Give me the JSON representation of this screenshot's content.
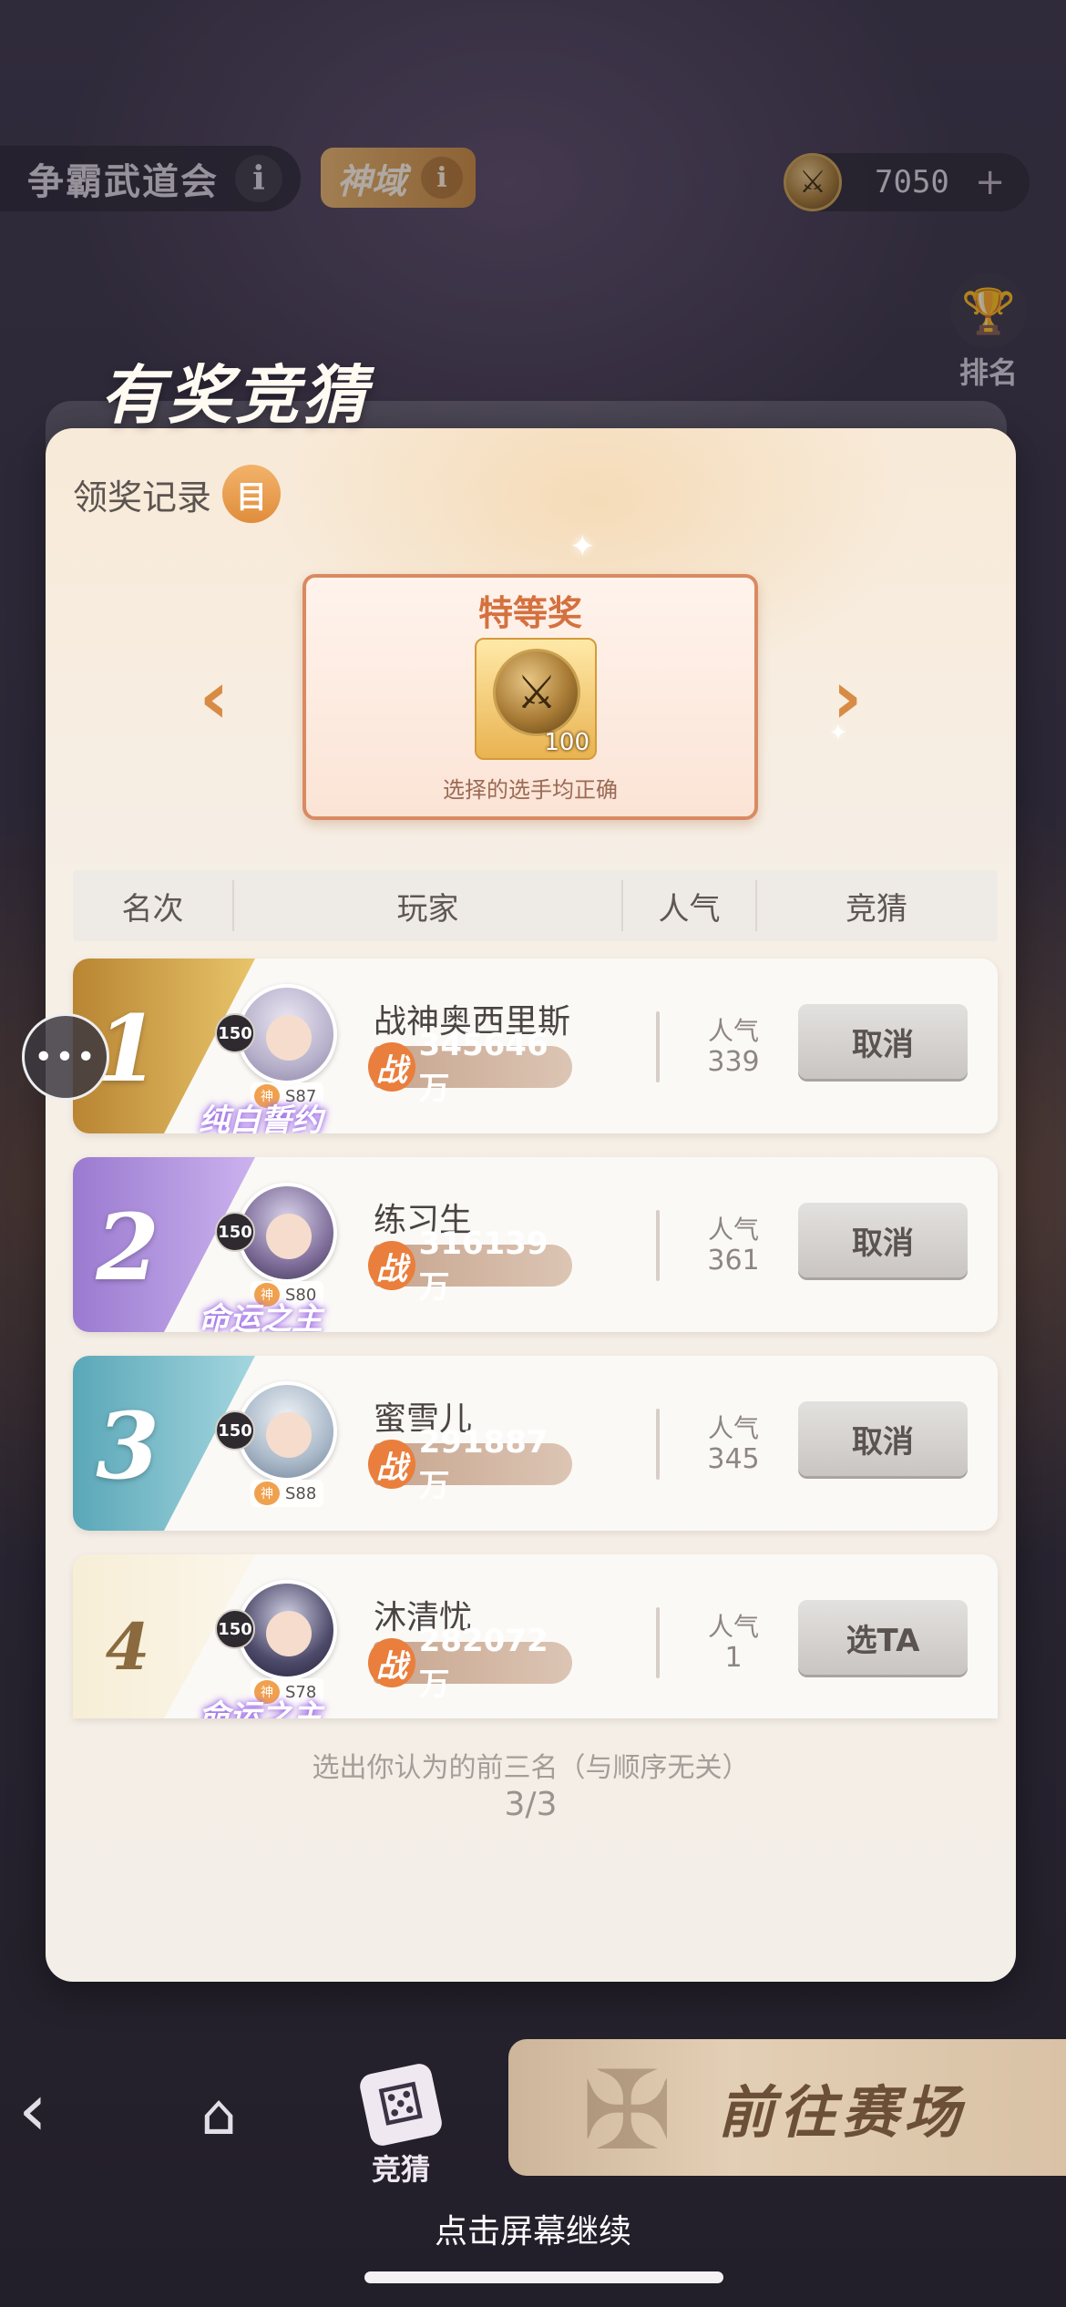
{
  "top_bar": {
    "event_title": "争霸武道会",
    "realm_tag": "神域",
    "info_glyph": "i",
    "currency_amount": "7050",
    "currency_plus": "+",
    "ranking_label": "排名"
  },
  "modal": {
    "title": "有奖竞猜",
    "records_label": "领奖记录",
    "records_icon_glyph": "目",
    "prize": {
      "title": "特等奖",
      "quantity": "100",
      "condition": "选择的选手均正确"
    },
    "table_headers": [
      "名次",
      "玩家",
      "人气",
      "竞猜"
    ],
    "popularity_label": "人气",
    "power_glyph": "战",
    "rows": [
      {
        "rank": "1",
        "level": "150",
        "server": "S87",
        "god_tag": "神",
        "title": "纯白誓约",
        "name": "战神奥西里斯",
        "power": "345646万",
        "popularity": "339",
        "button": "取消"
      },
      {
        "rank": "2",
        "level": "150",
        "server": "S80",
        "god_tag": "神",
        "title": "命运之主",
        "name": "练习生",
        "power": "316139万",
        "popularity": "361",
        "button": "取消"
      },
      {
        "rank": "3",
        "level": "150",
        "server": "S88",
        "god_tag": "神",
        "title": "",
        "name": "蜜雪儿",
        "power": "291887万",
        "popularity": "345",
        "button": "取消"
      },
      {
        "rank": "4",
        "level": "150",
        "server": "S78",
        "god_tag": "神",
        "title": "命运之主",
        "name": "沐清忧",
        "power": "282072万",
        "popularity": "1",
        "button": "选TA"
      }
    ],
    "hint": "选出你认为的前三名（与顺序无关）",
    "selected_count": "3/3"
  },
  "bottom_nav": {
    "guess_label": "竞猜",
    "go_arena_label": "前往赛场",
    "tap_continue": "点击屏幕继续"
  },
  "icons": {
    "back": "back-arrow-icon",
    "home": "home-icon",
    "dice": "dice-icon",
    "coin": "coin-icon",
    "trophy": "trophy-icon",
    "chat": "chat-icon"
  },
  "colors": {
    "accent_orange": "#e08d3c",
    "rank1": "#c9963a",
    "rank2": "#a98ad6",
    "rank3": "#6fb3c2",
    "rank4": "#f6eedd"
  }
}
